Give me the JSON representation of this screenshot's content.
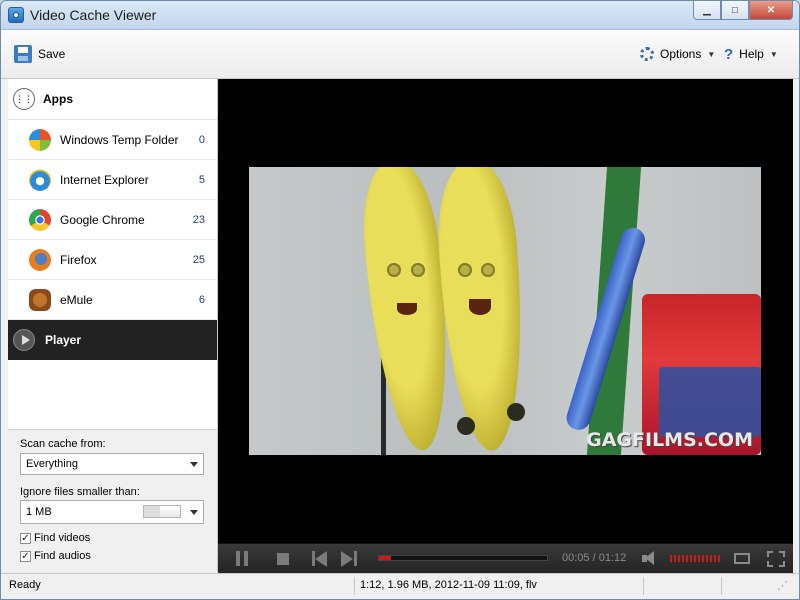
{
  "window": {
    "title": "Video Cache Viewer"
  },
  "toolbar": {
    "save_label": "Save",
    "options_label": "Options",
    "help_label": "Help"
  },
  "sidebar": {
    "apps_label": "Apps",
    "items": [
      {
        "label": "Windows Temp Folder",
        "count": "0",
        "icon": "windows-icon"
      },
      {
        "label": "Internet Explorer",
        "count": "5",
        "icon": "internet-explorer-icon"
      },
      {
        "label": "Google Chrome",
        "count": "23",
        "icon": "chrome-icon"
      },
      {
        "label": "Firefox",
        "count": "25",
        "icon": "firefox-icon"
      },
      {
        "label": "eMule",
        "count": "6",
        "icon": "emule-icon"
      }
    ],
    "player_label": "Player"
  },
  "settings": {
    "scan_label": "Scan cache from:",
    "scan_value": "Everything",
    "ignore_label": "Ignore files smaller than:",
    "ignore_value": "1 MB",
    "find_videos_label": "Find videos",
    "find_videos_checked": true,
    "find_audios_label": "Find audios",
    "find_audios_checked": true
  },
  "video": {
    "watermark": "GAGFILMS.COM"
  },
  "player": {
    "time": "00:05 / 01:12",
    "progress": 0.07
  },
  "status": {
    "left": "Ready",
    "details": "1:12,  1.96 MB,  2012-11-09 11:09,  flv"
  },
  "colors": {
    "accent_red": "#c81c1c",
    "count_blue": "#1d3e8f",
    "player_bg": "#222222"
  }
}
